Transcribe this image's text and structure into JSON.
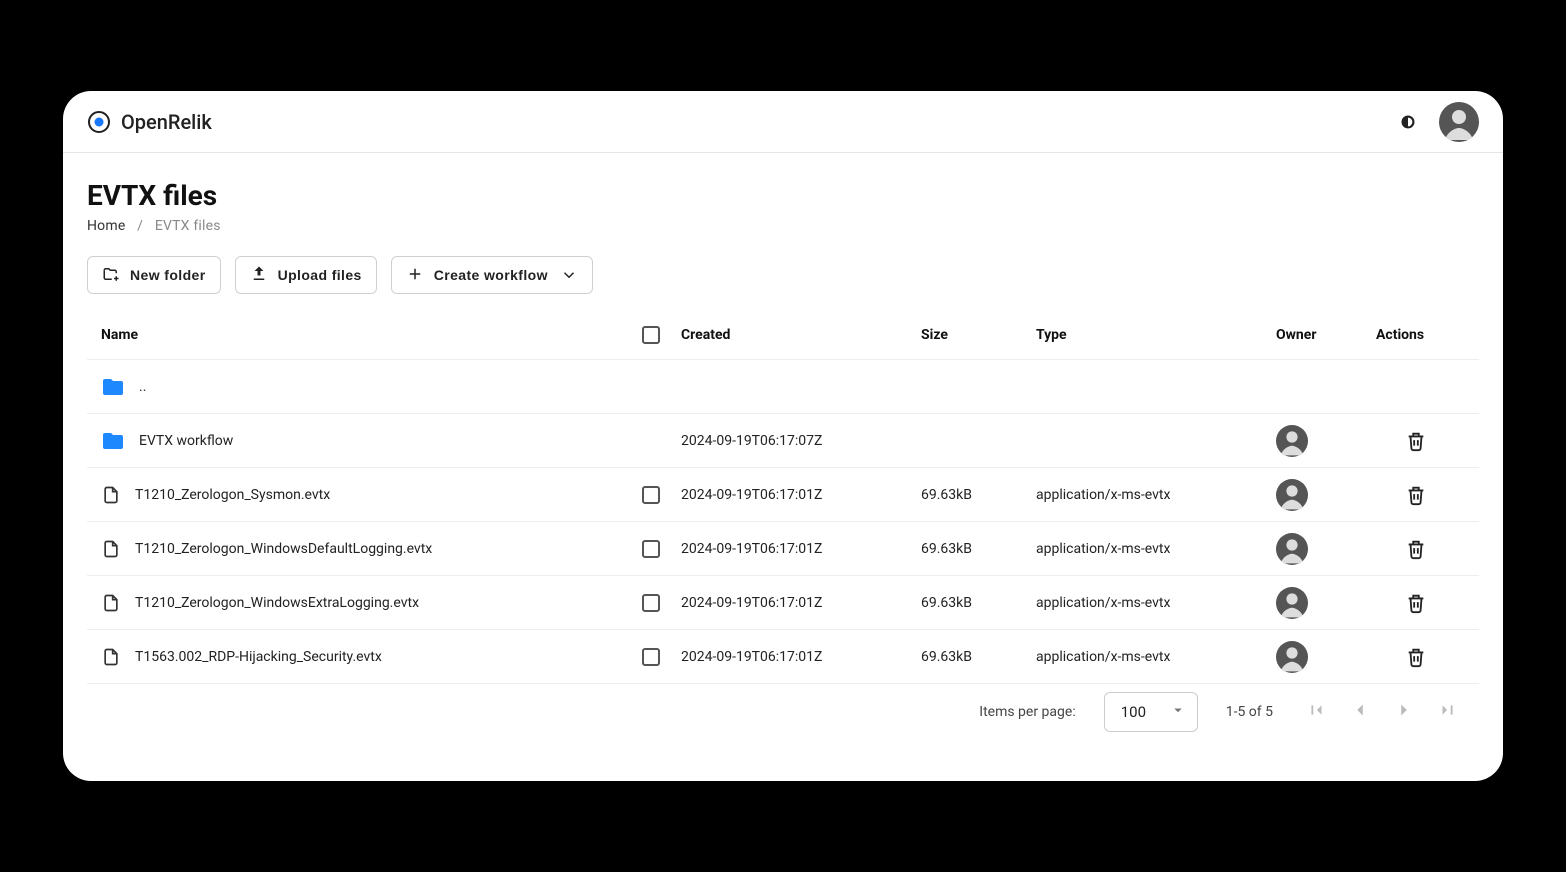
{
  "app": {
    "name": "OpenRelik"
  },
  "page": {
    "title": "EVTX files",
    "breadcrumb": {
      "home": "Home",
      "current": "EVTX files"
    }
  },
  "toolbar": {
    "new_folder": "New folder",
    "upload_files": "Upload files",
    "create_workflow": "Create workflow"
  },
  "table": {
    "headers": {
      "name": "Name",
      "created": "Created",
      "size": "Size",
      "type": "Type",
      "owner": "Owner",
      "actions": "Actions"
    },
    "parent_label": "..",
    "rows": [
      {
        "kind": "folder",
        "name": "EVTX workflow",
        "created": "2024-09-19T06:17:07Z",
        "size": "",
        "type": "",
        "has_owner": true,
        "has_delete": true,
        "checkable": false
      },
      {
        "kind": "file",
        "name": "T1210_Zerologon_Sysmon.evtx",
        "created": "2024-09-19T06:17:01Z",
        "size": "69.63kB",
        "type": "application/x-ms-evtx",
        "has_owner": true,
        "has_delete": true,
        "checkable": true
      },
      {
        "kind": "file",
        "name": "T1210_Zerologon_WindowsDefaultLogging.evtx",
        "created": "2024-09-19T06:17:01Z",
        "size": "69.63kB",
        "type": "application/x-ms-evtx",
        "has_owner": true,
        "has_delete": true,
        "checkable": true
      },
      {
        "kind": "file",
        "name": "T1210_Zerologon_WindowsExtraLogging.evtx",
        "created": "2024-09-19T06:17:01Z",
        "size": "69.63kB",
        "type": "application/x-ms-evtx",
        "has_owner": true,
        "has_delete": true,
        "checkable": true
      },
      {
        "kind": "file",
        "name": "T1563.002_RDP-Hijacking_Security.evtx",
        "created": "2024-09-19T06:17:01Z",
        "size": "69.63kB",
        "type": "application/x-ms-evtx",
        "has_owner": true,
        "has_delete": true,
        "checkable": true
      }
    ]
  },
  "pagination": {
    "items_per_page_label": "Items per page:",
    "items_per_page_value": "100",
    "range": "1-5 of 5"
  }
}
